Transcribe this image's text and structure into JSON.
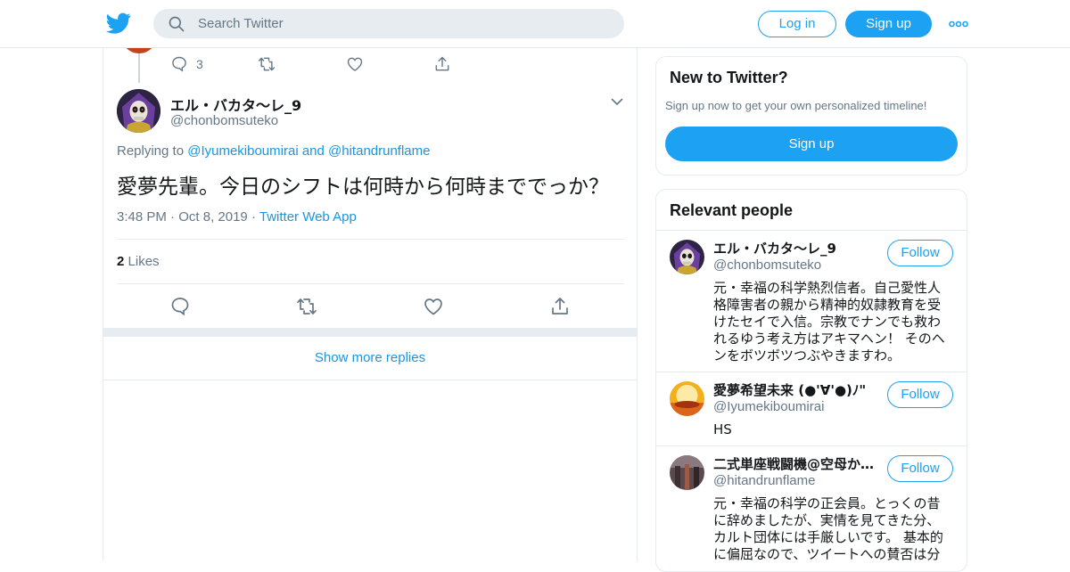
{
  "header": {
    "search_placeholder": "Search Twitter",
    "login_label": "Log in",
    "signup_label": "Sign up",
    "brand_color": "#1da1f2"
  },
  "previous_tweet": {
    "reply_count": "3"
  },
  "tweet": {
    "display_name": "エル・バカタ～レ_9",
    "handle": "@chonbomsuteko",
    "replying_prefix": "Replying to ",
    "replying_user1": "@Iyumekiboumirai",
    "replying_and": " and ",
    "replying_user2": "@hitandrunflame",
    "text": "愛夢先輩。今日のシフトは何時から何時まででっか？",
    "time": "3:48 PM",
    "date": "Oct 8, 2019",
    "source": "Twitter Web App",
    "likes_count": "2",
    "likes_label": "Likes"
  },
  "show_more_label": "Show more replies",
  "sidebar": {
    "new_title": "New to Twitter?",
    "new_subtitle": "Sign up now to get your own personalized timeline!",
    "new_signup_label": "Sign up",
    "relevant_title": "Relevant people",
    "people": [
      {
        "name": "エル・バカタ～レ_9",
        "handle": "@chonbomsuteko",
        "follow_label": "Follow",
        "bio": "元・幸福の科学熱烈信者。自己愛性人格障害者の親から精神的奴隷教育を受けたセイで入信。宗教でナンでも救われるゆう考え方はアキマヘン！ そのヘンをボツボツつぶやきますわ。"
      },
      {
        "name": "愛夢希望未来 (●'∀'●)ﾉ\"",
        "handle": "@Iyumekiboumirai",
        "follow_label": "Follow",
        "bio": "HS"
      },
      {
        "name": "二式単座戦闘機@空母か…",
        "handle": "@hitandrunflame",
        "follow_label": "Follow",
        "bio": "元・幸福の科学の正会員。とっくの昔に辞めましたが、実情を見てきた分、カルト団体には手厳しいです。 基本的に偏屈なので、ツイートへの賛否は分"
      }
    ]
  }
}
